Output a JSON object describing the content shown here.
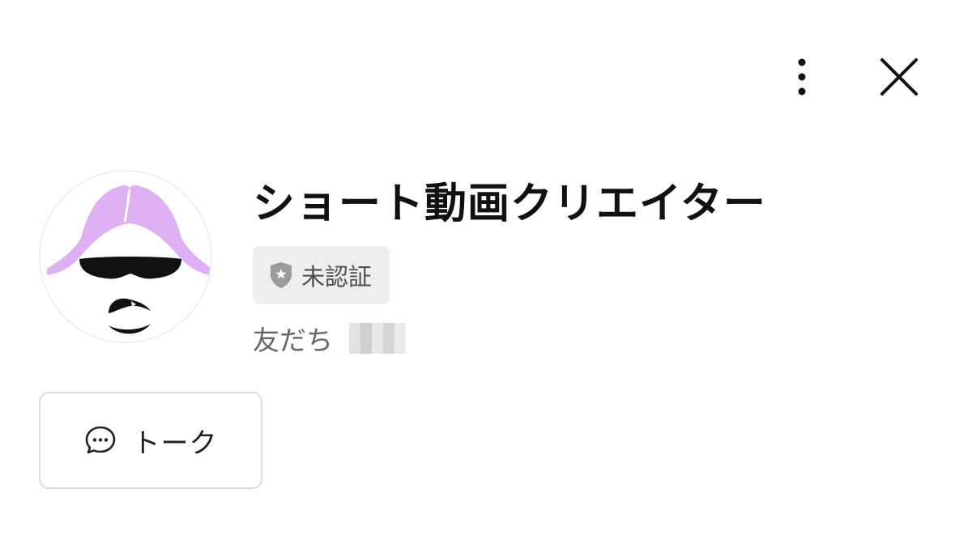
{
  "header": {
    "more_icon": "vertical-ellipsis-icon",
    "close_icon": "close-icon"
  },
  "profile": {
    "name": "ショート動画クリエイター",
    "badge": {
      "icon": "shield-star-icon",
      "label": "未認証"
    },
    "friends_label": "友だち"
  },
  "actions": {
    "talk": {
      "icon": "speech-bubble-icon",
      "label": "トーク"
    }
  },
  "colors": {
    "avatar_hair": "#dcb0f2",
    "badge_background": "#eeeeee",
    "button_border": "#dcdcdc"
  }
}
